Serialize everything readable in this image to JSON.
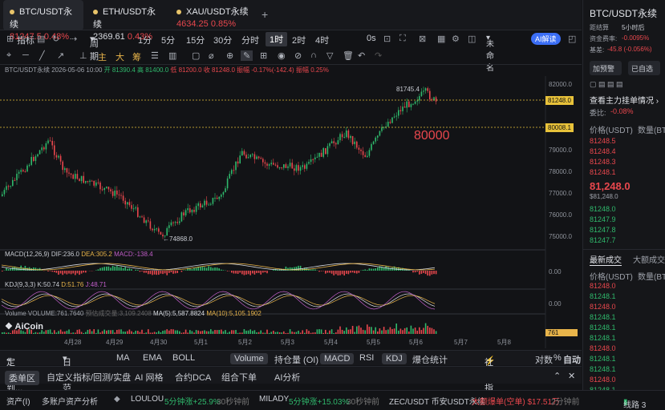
{
  "tabs": [
    {
      "name": "BTC/USDT永续",
      "price": "81247.5",
      "change": "0.48%"
    },
    {
      "name": "ETH/USDT永续",
      "price": "2369.61",
      "change": "0.43%"
    },
    {
      "name": "XAU/USDT永续",
      "price": "4634.25",
      "change": "0.85%"
    }
  ],
  "add_tab": "+",
  "toolbar1": {
    "indicator": "指标",
    "period": "周期",
    "intervals": [
      "1分",
      "5分",
      "15分",
      "30分",
      "分时",
      "1时",
      "2时",
      "4时"
    ],
    "active": "1时",
    "os": "0s",
    "unnamed": "未命名",
    "ai": "AI解读"
  },
  "toolbar2": {
    "labels": [
      "主",
      "大",
      "筹"
    ]
  },
  "info": {
    "symbol": "BTC/USDT永续",
    "date": "2026-05-06 10:00",
    "open": "开 81390.4",
    "high": "高 81400.0",
    "low": "低 81200.0",
    "close": "收 81248.0",
    "amp": "振幅 -0.17%(-142.4)",
    "range": "振幅 0.25%"
  },
  "chart": {
    "yticks": [
      "82000.0",
      "81000.0",
      "80000.0",
      "79000.0",
      "78000.0",
      "77000.0",
      "76000.0",
      "75000.0"
    ],
    "price_tag": "81248.0",
    "level_tag": "80008.1",
    "annotation": "80000",
    "high_mark": "81745.4",
    "low_mark": "74868.0",
    "xticks": [
      "4月28",
      "4月29",
      "4月30",
      "5月1",
      "5月2",
      "5月3",
      "5月4",
      "5月5",
      "5月6",
      "5月7",
      "5月8"
    ]
  },
  "macd": {
    "label": "MACD(12,26,9)",
    "dif": "DIF:236.0",
    "dea": "DEA:305.2",
    "macd": "MACD:-138.4",
    "zero": "0.00"
  },
  "kdj": {
    "label": "KDJ(9,3,3)",
    "k": "K:50.74",
    "d": "D:51.76",
    "j": "J:48.71",
    "zero": "0.00"
  },
  "vol": {
    "label": "Volume",
    "vol": "VOLUME:761.7640",
    "est": "预估成交量:3,109.2408",
    "ma5": "MA(5):5,587.8824",
    "ma10": "MA(10):5,105.1902",
    "tag": "761"
  },
  "logo": "AiCoin",
  "bottom1": {
    "items": [
      "定位到...",
      "日期范围",
      "MA",
      "EMA",
      "BOLL",
      "Volume",
      "持仓量 (OI)",
      "MACD",
      "RSI",
      "KDJ",
      "爆仓统计"
    ],
    "community": "社区指标",
    "pair": "对数",
    "pct": "%",
    "auto": "自动"
  },
  "bottom2": {
    "items": [
      "委单区",
      "自定义指标/回测/实盘",
      "AI 网格",
      "合约DCA",
      "组合下单",
      "AI分析"
    ]
  },
  "bottom3": {
    "assets": "资产(Ⅰ)",
    "multi": "多账户资产分析",
    "ticker1": "LOULOU",
    "ticker1_change": "5分钟涨+25.9%",
    "ticker1_time": "30秒钟前",
    "ticker2": "MILADY",
    "ticker2_change": "5分钟涨+15.03%",
    "ticker2_time": "30秒钟前",
    "ticker3": "ZEC/USDT 币安USDT永续",
    "ticker3_change": "大额爆单(空单) $17.51万",
    "ticker3_time": "2分钟前",
    "line": "线路 3"
  },
  "right": {
    "title": "BTC/USDT永续",
    "next": "距结算",
    "next_v": "5小时后",
    "fund": "资金费率:",
    "fund_v": "-0.0095%",
    "basis": "基差:",
    "basis_v": "-45.8 (-0.056%)",
    "btn1": "加预警",
    "btn2": "已自选",
    "depth_link": "查看主力挂单情况",
    "ratio": "委比:",
    "ratio_v": "-0.08%",
    "price_h": "价格(USDT)",
    "qty_h": "数量(BT",
    "asks": [
      "81248.5",
      "81248.4",
      "81248.3",
      "81248.2",
      "81248.1"
    ],
    "last": "81,248.0",
    "last_usd": "$81,248.0",
    "bids": [
      "81248.0",
      "81247.9",
      "81247.8",
      "81247.7"
    ],
    "trades_tab": "最新成交",
    "big_tab": "大额成交",
    "trades": [
      {
        "p": "81248.0",
        "c": "red"
      },
      {
        "p": "81248.1",
        "c": "grn"
      },
      {
        "p": "81248.0",
        "c": "red"
      },
      {
        "p": "81248.1",
        "c": "grn"
      },
      {
        "p": "81248.1",
        "c": "grn"
      },
      {
        "p": "81248.1",
        "c": "grn"
      },
      {
        "p": "81248.0",
        "c": "red"
      },
      {
        "p": "81248.1",
        "c": "grn"
      },
      {
        "p": "81248.1",
        "c": "grn"
      },
      {
        "p": "81248.0",
        "c": "red"
      },
      {
        "p": "81248.1",
        "c": "grn"
      }
    ]
  },
  "colors": {
    "up": "#2fb96c",
    "down": "#e8474d",
    "gold": "#e8b44a",
    "bg": "#121316"
  }
}
